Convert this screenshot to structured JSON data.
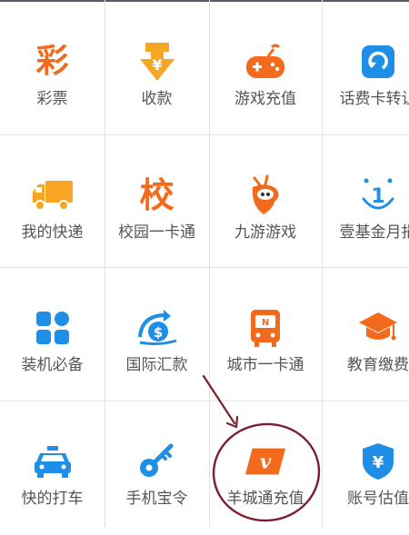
{
  "colors": {
    "orange": "#f26b1d",
    "blue": "#1f8ee6",
    "yellow": "#f6a623",
    "annotation": "#7b1e2c"
  },
  "services": [
    {
      "label": "彩票",
      "icon": "lottery-icon",
      "glyph": "彩"
    },
    {
      "label": "收款",
      "icon": "receive-money-icon",
      "glyph": "¥"
    },
    {
      "label": "游戏充值",
      "icon": "gamepad-icon"
    },
    {
      "label": "话费卡转让",
      "icon": "phone-card-transfer-icon"
    },
    {
      "label": "我的快递",
      "icon": "delivery-truck-icon"
    },
    {
      "label": "校园一卡通",
      "icon": "campus-card-icon",
      "glyph": "校"
    },
    {
      "label": "九游游戏",
      "icon": "jiuyou-mascot-icon"
    },
    {
      "label": "壹基金月捐",
      "icon": "one-foundation-icon",
      "glyph": "1"
    },
    {
      "label": "装机必备",
      "icon": "app-grid-icon"
    },
    {
      "label": "国际汇款",
      "icon": "international-remittance-icon",
      "glyph": "$"
    },
    {
      "label": "城市一卡通",
      "icon": "city-card-icon",
      "glyph": "N"
    },
    {
      "label": "教育缴费",
      "icon": "graduation-cap-icon"
    },
    {
      "label": "快的打车",
      "icon": "taxi-icon"
    },
    {
      "label": "手机宝令",
      "icon": "key-icon"
    },
    {
      "label": "羊城通充值",
      "icon": "yangchengtong-icon",
      "glyph": "v"
    },
    {
      "label": "账号估值",
      "icon": "shield-yuan-icon",
      "glyph": "¥"
    }
  ]
}
